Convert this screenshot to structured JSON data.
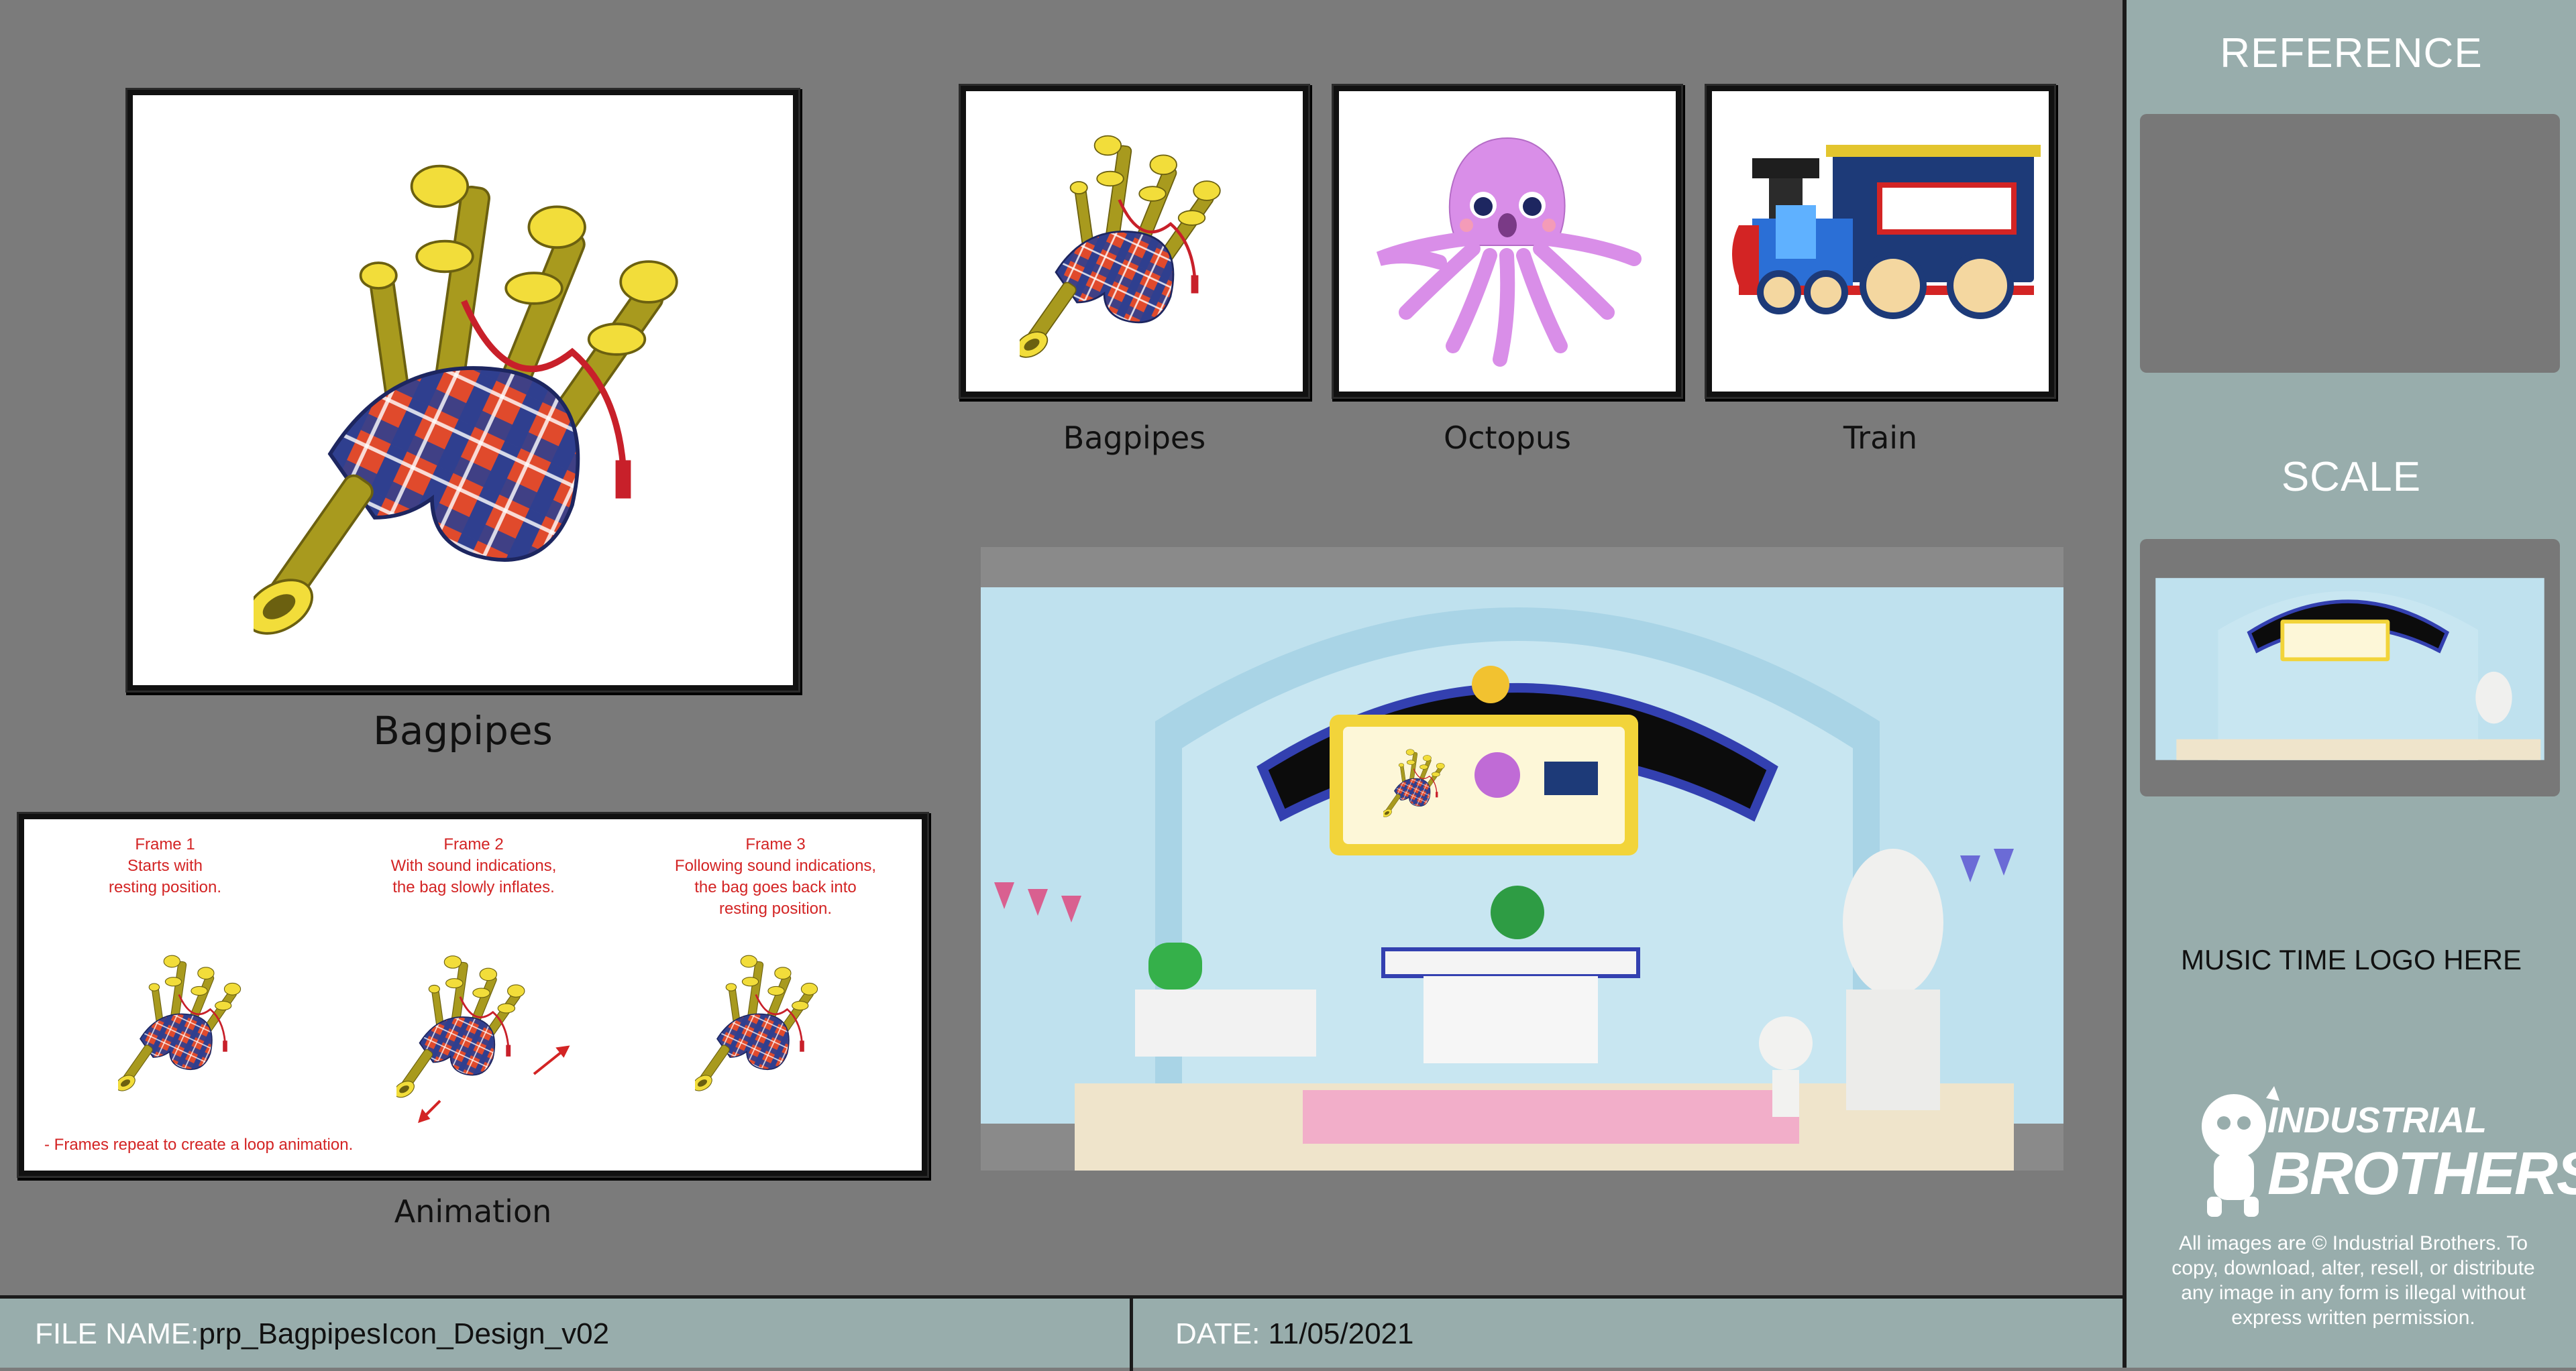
{
  "main_card": {
    "caption": "Bagpipes"
  },
  "reference_cards": [
    {
      "caption": "Bagpipes",
      "icon": "bagpipes-illustration"
    },
    {
      "caption": "Octopus",
      "icon": "octopus-illustration"
    },
    {
      "caption": "Train",
      "icon": "train-illustration"
    }
  ],
  "animation": {
    "caption": "Animation",
    "frames": [
      {
        "title": "Frame 1",
        "lines": [
          "Starts with",
          "resting position."
        ]
      },
      {
        "title": "Frame 2",
        "lines": [
          "With sound indications,",
          "the bag slowly inflates."
        ]
      },
      {
        "title": "Frame 3",
        "lines": [
          "Following sound indications,",
          "the bag goes back into",
          "resting position."
        ]
      }
    ],
    "note": "- Frames repeat to create a loop animation."
  },
  "sidebar": {
    "reference_title": "REFERENCE",
    "scale_title": "SCALE",
    "logo_placeholder": "MUSIC TIME LOGO HERE",
    "brand_line1": "INDUSTRIAL",
    "brand_line2": "BROTHERS",
    "copyright": "All images are © Industrial Brothers. To copy, download, alter, resell, or distribute any image in any form is illegal without express written permission."
  },
  "footer": {
    "file_label": "FILE NAME:",
    "file_value": "prp_BagpipesIcon_Design_v02",
    "date_label": "DATE:",
    "date_value": "11/05/2021"
  },
  "colors": {
    "background": "#7b7b7b",
    "sidebar": "#98adac",
    "red_text": "#d32424",
    "bag_blue": "#2f3f8f",
    "bag_red": "#e04a2c",
    "pipe_gold": "#a89a1e",
    "pipe_yellow": "#f2dd3a",
    "octopus": "#d98ee8",
    "train_blue": "#1d3a78",
    "set_blue": "#bfe1ee"
  }
}
